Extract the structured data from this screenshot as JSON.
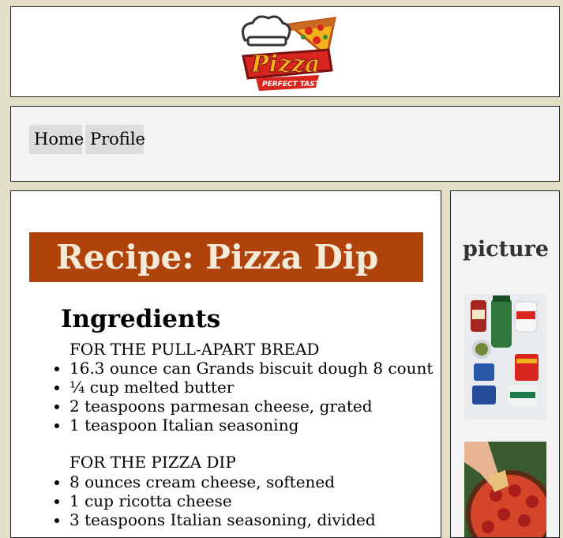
{
  "header": {
    "logo_text": "Pizza",
    "logo_tagline": "PERFECT TASTE"
  },
  "nav": {
    "items": [
      {
        "label": "Home"
      },
      {
        "label": "Profile"
      }
    ]
  },
  "main": {
    "title": "Recipe: Pizza Dip",
    "ingredients_heading": "Ingredients",
    "sections": [
      {
        "title": "FOR THE PULL-APART BREAD",
        "items": [
          "16.3 ounce can Grands biscuit dough 8 count",
          "¼ cup melted butter",
          "2 teaspoons parmesan cheese, grated",
          "1 teaspoon Italian seasoning"
        ]
      },
      {
        "title": "FOR THE PIZZA DIP",
        "items": [
          "8 ounces cream cheese, softened",
          "1 cup ricotta cheese",
          "3 teaspoons Italian seasoning, divided"
        ]
      }
    ]
  },
  "aside": {
    "title": "picture",
    "images": [
      {
        "name": "ingredients-photo"
      },
      {
        "name": "pizza-dip-photo"
      }
    ]
  },
  "colors": {
    "page_background": "#e3dfc6",
    "title_bar": "#b0420c",
    "title_text": "#f5e9d8",
    "nav_button": "#dddddd",
    "logo_red": "#d8261e",
    "logo_yellow": "#f2b21b"
  }
}
